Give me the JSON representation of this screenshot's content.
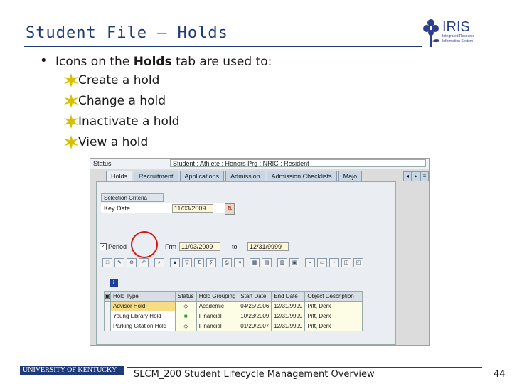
{
  "slide": {
    "title": "Student File – Holds",
    "bullet_prefix": "Icons on the ",
    "bullet_bold": "Holds",
    "bullet_suffix": " tab are used to:",
    "sub_items": [
      "Create a hold",
      "Change a hold",
      "Inactivate a hold",
      "View a hold"
    ],
    "footer_logo_text": "UNIVERSITY OF KENTUCKY",
    "footer_text": "SLCM_200 Student Lifecycle Management Overview",
    "page_number": "44",
    "colors": {
      "title": "#1f3a78",
      "highlight_circle": "#d11111",
      "star": "#d8c000"
    }
  },
  "logo": {
    "name": "IRIS",
    "subtitle_line1": "Integrated Resource",
    "subtitle_line2": "Information System"
  },
  "sap": {
    "status_label": "Status",
    "status_value": "Student ; Athlete ; Honors Prg ; NRIC ; Resident",
    "tabs": [
      "Holds",
      "Recruitment",
      "Applications",
      "Admission",
      "Admission Checklists",
      "Majo"
    ],
    "criteria_label": "Selection Criteria",
    "key_date_label": "Key Date",
    "key_date_value": "11/03/2009",
    "period_label": "Period",
    "from_label": "Frm",
    "from_value": "11/03/2009",
    "to_label": "to",
    "to_value": "12/31/9999",
    "columns": [
      "Hold Type",
      "Status",
      "Hold Grouping",
      "Start Date",
      "End Date",
      "Object Description"
    ],
    "rows": [
      {
        "hold_type": "Advisor Hold",
        "status": "◇",
        "grouping": "Academic",
        "start": "04/25/2006",
        "end": "12/31/9999",
        "desc": "Pitt, Derk"
      },
      {
        "hold_type": "Young Library Hold",
        "status": "■",
        "grouping": "Financial",
        "start": "10/23/2009",
        "end": "12/31/9999",
        "desc": "Pitt, Derk"
      },
      {
        "hold_type": "Parking Citation Hold",
        "status": "◇",
        "grouping": "Financial",
        "start": "01/29/2007",
        "end": "12/31/9999",
        "desc": "Pitt, Derk"
      }
    ]
  }
}
